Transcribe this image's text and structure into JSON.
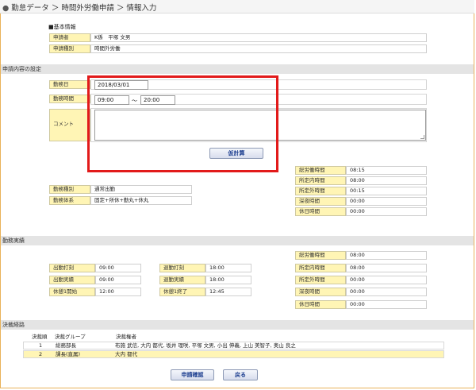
{
  "breadcrumb": {
    "bullet": "●",
    "text": "勤怠データ ＞ 時間外労働申請 ＞ 情報入力"
  },
  "basic_info": {
    "heading": "■基本情報",
    "applicant_label": "申請者",
    "applicant_value": "K係　平塚 文男",
    "type_label": "申請種別",
    "type_value": "時間外労働"
  },
  "application_section": {
    "title": "申請内容の設定",
    "date_label": "勤務日",
    "date_value": "2018/03/01",
    "time_label": "勤務時間",
    "start_time": "09:00",
    "tilde": "～",
    "end_time": "20:00",
    "comment_label": "コメント",
    "comment_value": "",
    "calc_button": "仮計算",
    "work_type_label": "勤務種別",
    "work_type_value": "通常出勤",
    "work_system_label": "勤務体系",
    "work_system_value": "固定+所休+勤丸+休丸",
    "summary": [
      {
        "label": "総労働時間",
        "value": "08:15"
      },
      {
        "label": "所定内時間",
        "value": "08:00"
      },
      {
        "label": "所定外時間",
        "value": "00:15"
      },
      {
        "label": "深夜時間",
        "value": "00:00"
      },
      {
        "label": "休日時間",
        "value": "00:00"
      }
    ]
  },
  "actual_section": {
    "title": "勤務実績",
    "attend_stamp_label": "出勤打刻",
    "attend_stamp_value": "09:00",
    "leave_stamp_label": "退勤打刻",
    "leave_stamp_value": "18:00",
    "attend_actual_label": "出勤実績",
    "attend_actual_value": "09:00",
    "leave_actual_label": "退勤実績",
    "leave_actual_value": "18:00",
    "break_start_label": "休憩1開始",
    "break_start_value": "12:00",
    "break_end_label": "休憩1終了",
    "break_end_value": "12:45",
    "summary": [
      {
        "label": "総労働時間",
        "value": "08:00"
      },
      {
        "label": "所定内時間",
        "value": "08:00"
      },
      {
        "label": "所定外時間",
        "value": "00:00"
      },
      {
        "label": "深夜時間",
        "value": "00:00"
      },
      {
        "label": "休日時間",
        "value": "00:00"
      }
    ]
  },
  "approval_section": {
    "title": "決裁経路",
    "headers": {
      "order": "決裁順",
      "group": "決裁グループ",
      "approvers": "決裁権者"
    },
    "rows": [
      {
        "order": "1",
        "group": "総務部長",
        "approvers": "布施 武信, 大内 都代, 坂井 理咲, 平塚 文男, 小出 伸義, 上山 美智子, 奥山 良之"
      },
      {
        "order": "2",
        "group": "課長(直属)",
        "approvers": "大内 都代"
      }
    ]
  },
  "footer": {
    "confirm_button": "申請確認",
    "back_button": "戻る"
  },
  "colors": {
    "label_bg": "#fff5b5",
    "button_text": "#1b3d8f",
    "highlight_border": "#e21a1a",
    "frame_border": "#e9b25a"
  }
}
